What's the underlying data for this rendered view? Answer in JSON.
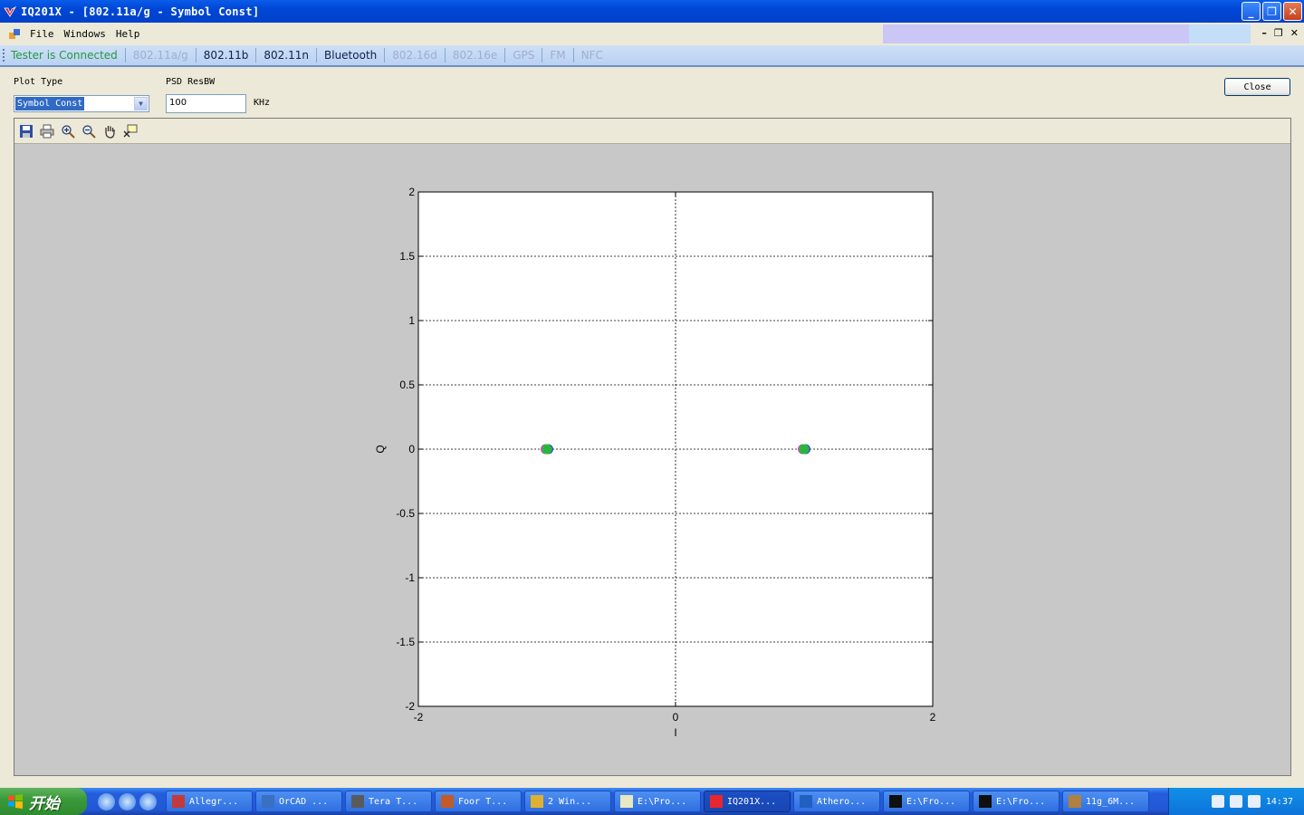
{
  "window": {
    "title": "IQ201X - [802.11a/g - Symbol Const]"
  },
  "menu": {
    "items": [
      "File",
      "Windows",
      "Help"
    ]
  },
  "tabs": {
    "status": "Tester is Connected",
    "items": [
      {
        "label": "802.11a/g",
        "enabled": false
      },
      {
        "label": "802.11b",
        "enabled": true
      },
      {
        "label": "802.11n",
        "enabled": true
      },
      {
        "label": "Bluetooth",
        "enabled": true
      },
      {
        "label": "802.16d",
        "enabled": false
      },
      {
        "label": "802.16e",
        "enabled": false
      },
      {
        "label": "GPS",
        "enabled": false
      },
      {
        "label": "FM",
        "enabled": false
      },
      {
        "label": "NFC",
        "enabled": false
      }
    ]
  },
  "controls": {
    "plot_type_label": "Plot Type",
    "plot_type_value": "Symbol Const",
    "psd_label": "PSD ResBW",
    "psd_value": "100",
    "psd_unit": "KHz",
    "close_label": "Close"
  },
  "toolbar_icons": [
    "save-icon",
    "print-icon",
    "zoom-in-icon",
    "zoom-out-icon",
    "pan-hand-icon",
    "data-cursor-icon"
  ],
  "chart_data": {
    "type": "scatter",
    "xlabel": "I",
    "ylabel": "Q",
    "xlim": [
      -2,
      2
    ],
    "ylim": [
      -2,
      2
    ],
    "xticks": [
      -2,
      0,
      2
    ],
    "yticks": [
      -2,
      -1.5,
      -1,
      -0.5,
      0,
      0.5,
      1,
      1.5,
      2
    ],
    "grid": true,
    "series": [
      {
        "color": "#cc33cc",
        "points": [
          [
            -1.01,
            0.0
          ],
          [
            0.99,
            0.0
          ]
        ]
      },
      {
        "color": "#3333dd",
        "points": [
          [
            -0.99,
            0.0
          ],
          [
            1.01,
            0.0
          ]
        ]
      },
      {
        "color": "#22cc22",
        "points": [
          [
            -1.0,
            0.0
          ],
          [
            1.0,
            0.0
          ]
        ]
      }
    ]
  },
  "taskbar": {
    "start_label": "开始",
    "tasks": [
      {
        "label": "Allegr...",
        "active": false
      },
      {
        "label": "OrCAD ...",
        "active": false
      },
      {
        "label": "Tera T...",
        "active": false
      },
      {
        "label": "Foor T...",
        "active": false
      },
      {
        "label": "2 Win...",
        "active": false
      },
      {
        "label": "E:\\Pro...",
        "active": false
      },
      {
        "label": "IQ201X...",
        "active": true
      },
      {
        "label": "Athero...",
        "active": false
      },
      {
        "label": "E:\\Fro...",
        "active": false
      },
      {
        "label": "E:\\Fro...",
        "active": false
      },
      {
        "label": "11g_6M...",
        "active": false
      }
    ],
    "clock": "14:37"
  },
  "colors": {
    "titlebar": "#0047d6",
    "status_text": "#26983e",
    "disabled_tab": "#9eaed0"
  }
}
